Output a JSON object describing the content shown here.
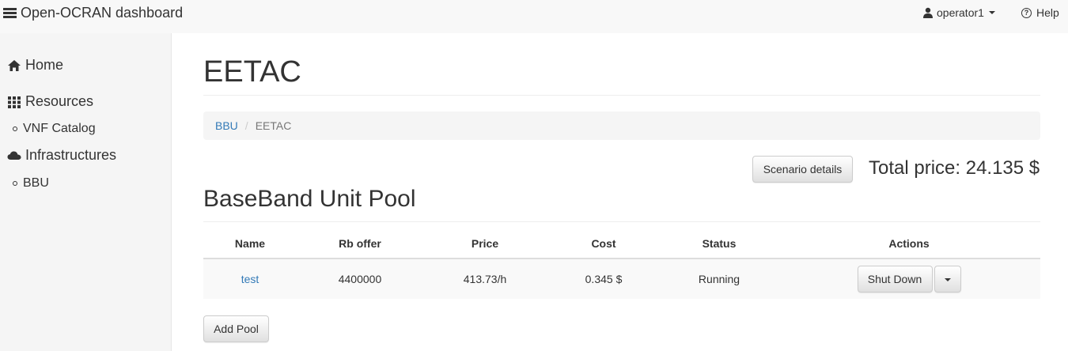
{
  "app": {
    "title": "Open-OCRAN dashboard",
    "user": "operator1",
    "help_label": "Help"
  },
  "sidebar": {
    "items": [
      {
        "label": "Home",
        "icon": "home-icon"
      },
      {
        "label": "Resources",
        "icon": "grid-icon"
      },
      {
        "label": "VNF Catalog",
        "icon": "circle-bullet"
      },
      {
        "label": "Infrastructures",
        "icon": "cloud-icon"
      },
      {
        "label": "BBU",
        "icon": "circle-bullet"
      }
    ]
  },
  "page": {
    "title": "EETAC",
    "breadcrumb": [
      {
        "label": "BBU",
        "link": true
      },
      {
        "label": "EETAC",
        "link": false
      }
    ],
    "scenario_button": "Scenario details",
    "total_price": "Total price: 24.135 $",
    "section_title": "BaseBand Unit Pool",
    "add_pool_button": "Add Pool"
  },
  "table": {
    "headers": [
      "Name",
      "Rb offer",
      "Price",
      "Cost",
      "Status",
      "Actions"
    ],
    "rows": [
      {
        "name": "test",
        "rb_offer": "4400000",
        "price": "413.73/h",
        "cost": "0.345 $",
        "status": "Running",
        "action": "Shut Down"
      }
    ]
  },
  "colors": {
    "link": "#337ab7",
    "navbar_bg": "#f8f8f8",
    "sidebar_bg": "#f5f5f5"
  }
}
